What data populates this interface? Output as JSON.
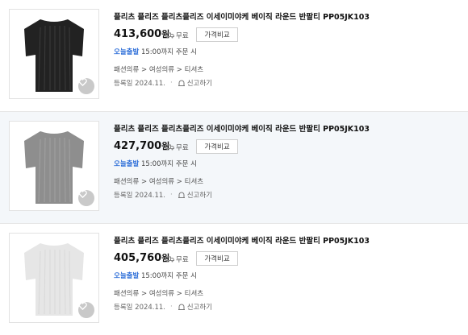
{
  "products": [
    {
      "title": "플리츠 플리즈 플리츠플리즈 이세이미야케 베이직 라운드 반팔티 PP05JK103",
      "price": "413,600",
      "currency": "원",
      "free_shipping": "무료",
      "compare_label": "가격비교",
      "ship_today": "오늘출발",
      "ship_note": "15:00까지 주문 시",
      "categories": [
        "패션의류",
        "여성의류",
        "티셔츠"
      ],
      "registered": "등록일 2024.11.",
      "report_label": "신고하기",
      "shirt_color": "#222222"
    },
    {
      "title": "플리츠 플리즈 플리츠플리즈 이세이미야케 베이직 라운드 반팔티 PP05JK103",
      "price": "427,700",
      "currency": "원",
      "free_shipping": "무료",
      "compare_label": "가격비교",
      "ship_today": "오늘출발",
      "ship_note": "15:00까지 주문 시",
      "categories": [
        "패션의류",
        "여성의류",
        "티셔츠"
      ],
      "registered": "등록일 2024.11.",
      "report_label": "신고하기",
      "shirt_color": "#8e8e8e"
    },
    {
      "title": "플리츠 플리즈 플리츠플리즈 이세이미야케 베이직 라운드 반팔티 PP05JK103",
      "price": "405,760",
      "currency": "원",
      "free_shipping": "무료",
      "compare_label": "가격비교",
      "ship_today": "오늘출발",
      "ship_note": "15:00까지 주문 시",
      "categories": [
        "패션의류",
        "여성의류",
        "티셔츠"
      ],
      "registered": "등록일 2024.11.",
      "report_label": "신고하기",
      "shirt_color": "#e6e6e6"
    }
  ],
  "colors": {
    "accent_blue": "#2f6fd8",
    "highlight_bg": "#f4f7fa"
  }
}
